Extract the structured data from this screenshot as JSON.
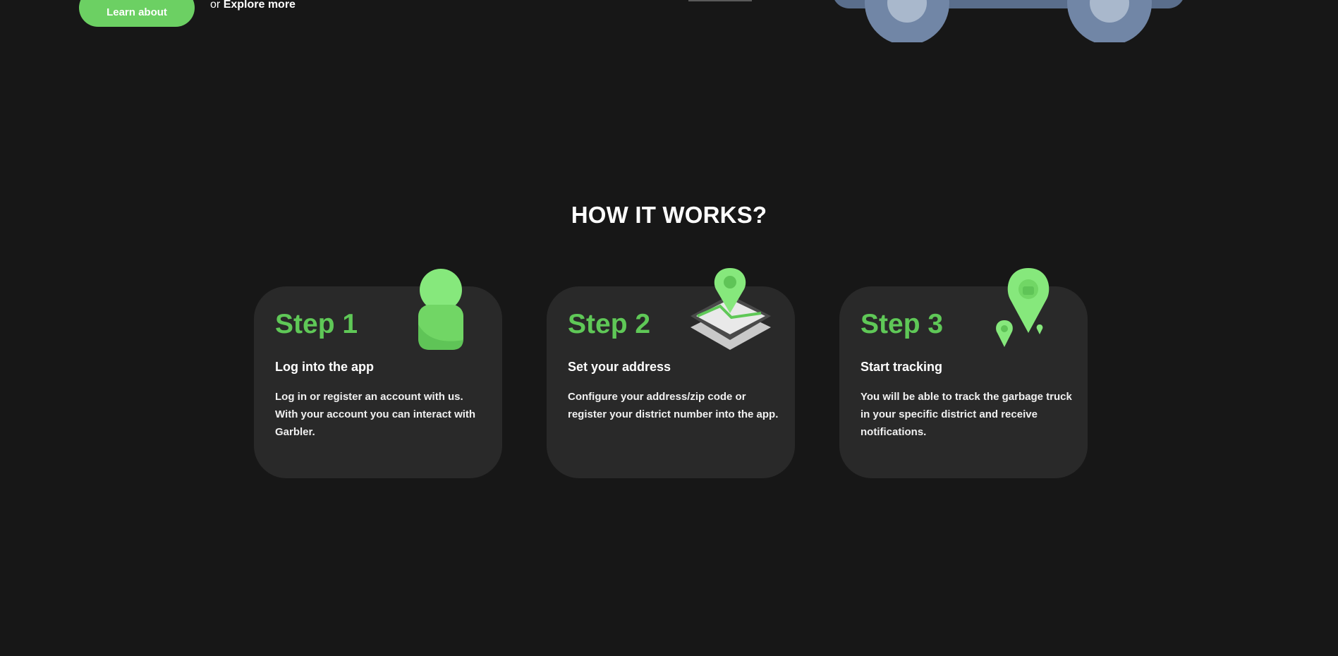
{
  "hero": {
    "learn_button": "Learn about",
    "explore_prefix": "or",
    "explore_link": "Explore more"
  },
  "how_it_works": {
    "title": "HOW IT WORKS?",
    "steps": [
      {
        "title": "Step 1",
        "heading": "Log into the app",
        "description": "Log in or register an account with us. With your account you can interact with Garbler.",
        "icon": "user-icon"
      },
      {
        "title": "Step 2",
        "heading": "Set your address",
        "description": "Configure your address/zip code or register your district number into the app.",
        "icon": "map-pin-icon"
      },
      {
        "title": "Step 3",
        "heading": "Start tracking",
        "description": "You will be able to track the garbage truck in your specific district and receive notifications.",
        "icon": "tracking-pins-icon"
      }
    ]
  },
  "colors": {
    "background": "#171717",
    "card": "#292929",
    "accent_green": "#5fc857",
    "button_green": "#6cd063"
  }
}
